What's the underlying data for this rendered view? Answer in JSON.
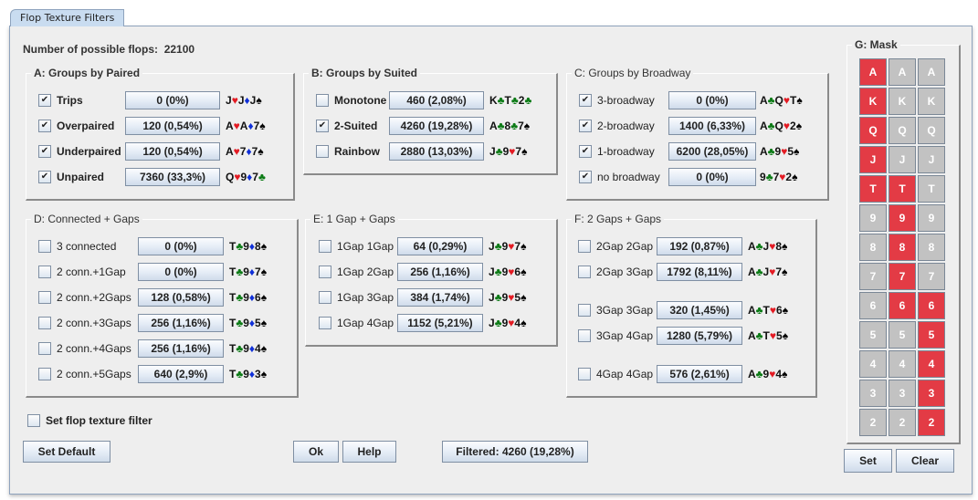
{
  "window": {
    "tab_label": "Flop Texture Filters"
  },
  "summary": {
    "possible_flops_label": "Number of possible flops:",
    "possible_flops_value": "22100"
  },
  "colors": {
    "heart": "#e31b23",
    "diamond": "#1030d8",
    "club": "#0a7a14",
    "spade": "#000000",
    "mask_on": "#e33b45",
    "mask_off": "#c2c2c2"
  },
  "groups": {
    "A": {
      "title": "A: Groups by Paired",
      "rows": [
        {
          "label": "Trips",
          "checked": true,
          "value": "0 (0%)",
          "example": [
            [
              "J",
              "h"
            ],
            [
              "J",
              "d"
            ],
            [
              "J",
              "s"
            ]
          ]
        },
        {
          "label": "Overpaired",
          "checked": true,
          "value": "120 (0,54%)",
          "example": [
            [
              "A",
              "h"
            ],
            [
              "A",
              "d"
            ],
            [
              "7",
              "s"
            ]
          ]
        },
        {
          "label": "Underpaired",
          "checked": true,
          "value": "120 (0,54%)",
          "example": [
            [
              "A",
              "h"
            ],
            [
              "7",
              "d"
            ],
            [
              "7",
              "s"
            ]
          ]
        },
        {
          "label": "Unpaired",
          "checked": true,
          "value": "7360 (33,3%)",
          "example": [
            [
              "Q",
              "h"
            ],
            [
              "9",
              "d"
            ],
            [
              "7",
              "c"
            ]
          ]
        }
      ]
    },
    "B": {
      "title": "B: Groups by Suited",
      "rows": [
        {
          "label": "Monotone",
          "checked": false,
          "value": "460 (2,08%)",
          "example": [
            [
              "K",
              "c"
            ],
            [
              "T",
              "c"
            ],
            [
              "2",
              "c"
            ]
          ]
        },
        {
          "label": "2-Suited",
          "checked": true,
          "value": "4260 (19,28%)",
          "example": [
            [
              "A",
              "c"
            ],
            [
              "8",
              "c"
            ],
            [
              "7",
              "s"
            ]
          ]
        },
        {
          "label": "Rainbow",
          "checked": false,
          "value": "2880 (13,03%)",
          "example": [
            [
              "J",
              "c"
            ],
            [
              "9",
              "h"
            ],
            [
              "7",
              "s"
            ]
          ]
        }
      ]
    },
    "C": {
      "title": "C: Groups by Broadway",
      "rows": [
        {
          "label": "3-broadway",
          "checked": true,
          "value": "0 (0%)",
          "example": [
            [
              "A",
              "c"
            ],
            [
              "Q",
              "h"
            ],
            [
              "T",
              "s"
            ]
          ]
        },
        {
          "label": "2-broadway",
          "checked": true,
          "value": "1400 (6,33%)",
          "example": [
            [
              "A",
              "c"
            ],
            [
              "Q",
              "h"
            ],
            [
              "2",
              "s"
            ]
          ]
        },
        {
          "label": "1-broadway",
          "checked": true,
          "value": "6200 (28,05%)",
          "example": [
            [
              "A",
              "c"
            ],
            [
              "9",
              "h"
            ],
            [
              "5",
              "s"
            ]
          ]
        },
        {
          "label": "no broadway",
          "checked": true,
          "value": "0 (0%)",
          "example": [
            [
              "9",
              "c"
            ],
            [
              "7",
              "h"
            ],
            [
              "2",
              "s"
            ]
          ]
        }
      ]
    },
    "D": {
      "title": "D: Connected + Gaps",
      "rows": [
        {
          "label": "3 connected",
          "checked": false,
          "value": "0 (0%)",
          "example": [
            [
              "T",
              "c"
            ],
            [
              "9",
              "d"
            ],
            [
              "8",
              "s"
            ]
          ]
        },
        {
          "label": "2 conn.+1Gap",
          "checked": false,
          "value": "0 (0%)",
          "example": [
            [
              "T",
              "c"
            ],
            [
              "9",
              "d"
            ],
            [
              "7",
              "s"
            ]
          ]
        },
        {
          "label": "2 conn.+2Gaps",
          "checked": false,
          "value": "128 (0,58%)",
          "example": [
            [
              "T",
              "c"
            ],
            [
              "9",
              "d"
            ],
            [
              "6",
              "s"
            ]
          ]
        },
        {
          "label": "2 conn.+3Gaps",
          "checked": false,
          "value": "256 (1,16%)",
          "example": [
            [
              "T",
              "c"
            ],
            [
              "9",
              "d"
            ],
            [
              "5",
              "s"
            ]
          ]
        },
        {
          "label": "2 conn.+4Gaps",
          "checked": false,
          "value": "256 (1,16%)",
          "example": [
            [
              "T",
              "c"
            ],
            [
              "9",
              "d"
            ],
            [
              "4",
              "s"
            ]
          ]
        },
        {
          "label": "2 conn.+5Gaps",
          "checked": false,
          "value": "640 (2,9%)",
          "example": [
            [
              "T",
              "c"
            ],
            [
              "9",
              "d"
            ],
            [
              "3",
              "s"
            ]
          ]
        }
      ]
    },
    "E": {
      "title": "E: 1 Gap + Gaps",
      "rows": [
        {
          "label": "1Gap 1Gap",
          "checked": false,
          "value": "64 (0,29%)",
          "example": [
            [
              "J",
              "c"
            ],
            [
              "9",
              "h"
            ],
            [
              "7",
              "s"
            ]
          ]
        },
        {
          "label": "1Gap 2Gap",
          "checked": false,
          "value": "256 (1,16%)",
          "example": [
            [
              "J",
              "c"
            ],
            [
              "9",
              "h"
            ],
            [
              "6",
              "s"
            ]
          ]
        },
        {
          "label": "1Gap 3Gap",
          "checked": false,
          "value": "384 (1,74%)",
          "example": [
            [
              "J",
              "c"
            ],
            [
              "9",
              "h"
            ],
            [
              "5",
              "s"
            ]
          ]
        },
        {
          "label": "1Gap 4Gap",
          "checked": false,
          "value": "1152 (5,21%)",
          "example": [
            [
              "J",
              "c"
            ],
            [
              "9",
              "h"
            ],
            [
              "4",
              "s"
            ]
          ]
        }
      ]
    },
    "F": {
      "title": "F: 2 Gaps + Gaps",
      "rows": [
        {
          "label": "2Gap 2Gap",
          "checked": false,
          "value": "192 (0,87%)",
          "example": [
            [
              "A",
              "c"
            ],
            [
              "J",
              "h"
            ],
            [
              "8",
              "s"
            ]
          ]
        },
        {
          "label": "2Gap 3Gap",
          "checked": false,
          "value": "1792 (8,11%)",
          "example": [
            [
              "A",
              "c"
            ],
            [
              "J",
              "h"
            ],
            [
              "7",
              "s"
            ]
          ]
        },
        {
          "label": "3Gap 3Gap",
          "checked": false,
          "value": "320 (1,45%)",
          "example": [
            [
              "A",
              "c"
            ],
            [
              "T",
              "h"
            ],
            [
              "6",
              "s"
            ]
          ]
        },
        {
          "label": "3Gap 4Gap",
          "checked": false,
          "value": "1280 (5,79%)",
          "example": [
            [
              "A",
              "c"
            ],
            [
              "T",
              "h"
            ],
            [
              "5",
              "s"
            ]
          ]
        },
        {
          "label": "4Gap 4Gap",
          "checked": false,
          "value": "576 (2,61%)",
          "example": [
            [
              "A",
              "c"
            ],
            [
              "9",
              "h"
            ],
            [
              "4",
              "s"
            ]
          ]
        }
      ]
    }
  },
  "set_filter": {
    "label": "Set flop texture filter",
    "checked": false
  },
  "buttons": {
    "set_default": "Set Default",
    "ok": "Ok",
    "help": "Help",
    "filtered": "Filtered: 4260 (19,28%)",
    "mask_set": "Set",
    "mask_clear": "Clear"
  },
  "mask": {
    "title": "G: Mask",
    "ranks": [
      "A",
      "K",
      "Q",
      "J",
      "T",
      "9",
      "8",
      "7",
      "6",
      "5",
      "4",
      "3",
      "2"
    ],
    "selected": [
      [
        true,
        false,
        false
      ],
      [
        true,
        false,
        false
      ],
      [
        true,
        false,
        false
      ],
      [
        true,
        false,
        false
      ],
      [
        true,
        true,
        false
      ],
      [
        false,
        true,
        false
      ],
      [
        false,
        true,
        false
      ],
      [
        false,
        true,
        false
      ],
      [
        false,
        true,
        true
      ],
      [
        false,
        false,
        true
      ],
      [
        false,
        false,
        true
      ],
      [
        false,
        false,
        true
      ],
      [
        false,
        false,
        true
      ]
    ]
  },
  "suit_glyphs": {
    "h": "♥",
    "d": "♦",
    "c": "♣",
    "s": "♠"
  }
}
